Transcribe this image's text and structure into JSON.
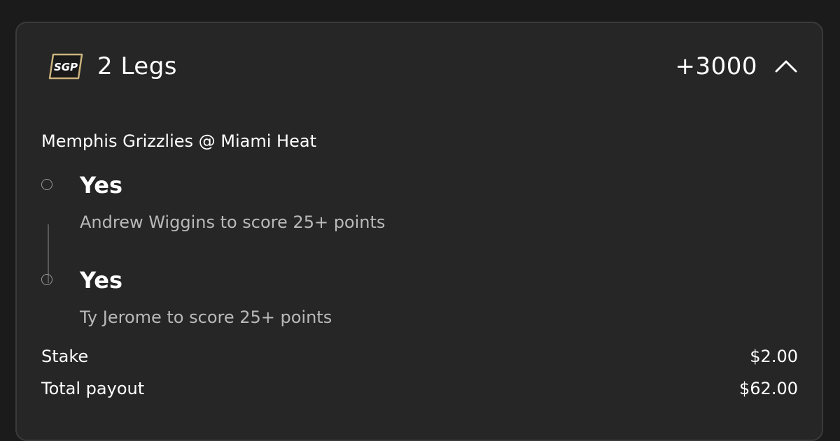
{
  "header": {
    "badge_label": "SGP",
    "title": "2 Legs",
    "odds": "+3000",
    "collapse_icon": "chevron-up-icon"
  },
  "event": {
    "matchup": "Memphis Grizzlies @ Miami Heat"
  },
  "legs": [
    {
      "selection": "Yes",
      "description": "Andrew Wiggins to score 25+ points"
    },
    {
      "selection": "Yes",
      "description": "Ty Jerome to score 25+ points"
    }
  ],
  "summary": {
    "stake_label": "Stake",
    "stake_value": "$2.00",
    "payout_label": "Total payout",
    "payout_value": "$62.00"
  },
  "colors": {
    "background": "#1b1b1b",
    "card": "#262626",
    "badge_gold": "#c9b27c",
    "muted_text": "#b9b9b9"
  }
}
